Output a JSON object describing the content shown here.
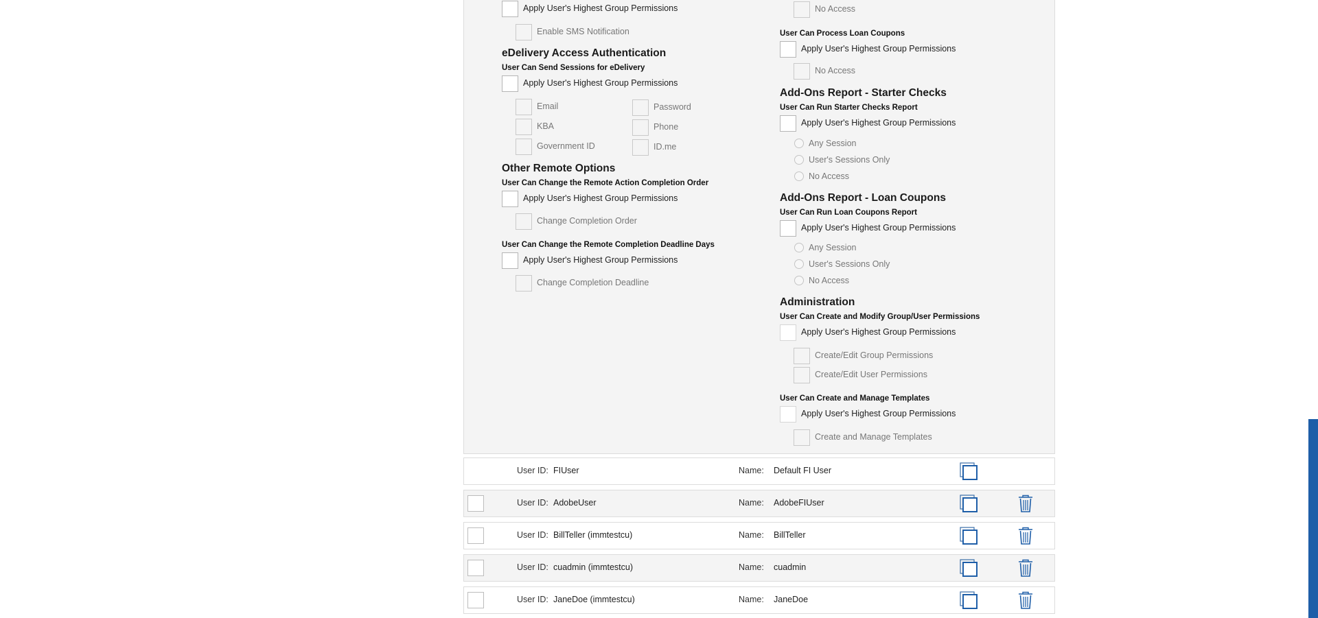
{
  "permissions": {
    "apply_label": "Apply User's Highest Group Permissions",
    "left": {
      "top_option": "Enable SMS Notification",
      "edelivery": {
        "title": "eDelivery Access Authentication",
        "subtitle": "User Can Send Sessions for eDelivery",
        "options": [
          "Email",
          "Password",
          "KBA",
          "Phone",
          "Government ID",
          "ID.me"
        ]
      },
      "other_remote": {
        "title": "Other Remote Options",
        "order_subtitle": "User Can Change the Remote Action Completion Order",
        "order_option": "Change Completion Order",
        "deadline_subtitle": "User Can Change the Remote Completion Deadline Days",
        "deadline_option": "Change Completion Deadline"
      }
    },
    "right": {
      "top_option": "No Access",
      "loan_coupons": {
        "subtitle": "User Can Process Loan Coupons",
        "option": "No Access"
      },
      "starter_checks": {
        "title": "Add-Ons Report - Starter Checks",
        "subtitle": "User Can Run Starter Checks Report",
        "radios": [
          "Any Session",
          "User's Sessions Only",
          "No Access"
        ]
      },
      "loan_coupons_report": {
        "title": "Add-Ons Report - Loan Coupons",
        "subtitle": "User Can Run Loan Coupons Report",
        "radios": [
          "Any Session",
          "User's Sessions Only",
          "No Access"
        ]
      },
      "administration": {
        "title": "Administration",
        "perm_subtitle": "User Can Create and Modify Group/User Permissions",
        "perm_options": [
          "Create/Edit Group Permissions",
          "Create/Edit User Permissions"
        ],
        "templates_subtitle": "User Can Create and Manage Templates",
        "templates_option": "Create and Manage Templates"
      }
    }
  },
  "users": {
    "user_id_label": "User ID:",
    "name_label": "Name:",
    "rows": [
      {
        "user_id": "FIUser",
        "name": "Default FI User"
      },
      {
        "user_id": "AdobeUser",
        "name": "AdobeFIUser"
      },
      {
        "user_id": "BillTeller (immtestcu)",
        "name": "BillTeller"
      },
      {
        "user_id": "cuadmin (immtestcu)",
        "name": "cuadmin"
      },
      {
        "user_id": "JaneDoe (immtestcu)",
        "name": "JaneDoe"
      }
    ]
  },
  "icons": {
    "check": "checkmark-icon",
    "copy": "copy-icon",
    "delete": "trash-icon"
  },
  "colors": {
    "accent": "#1e5ea8",
    "check": "#3a6da8"
  }
}
